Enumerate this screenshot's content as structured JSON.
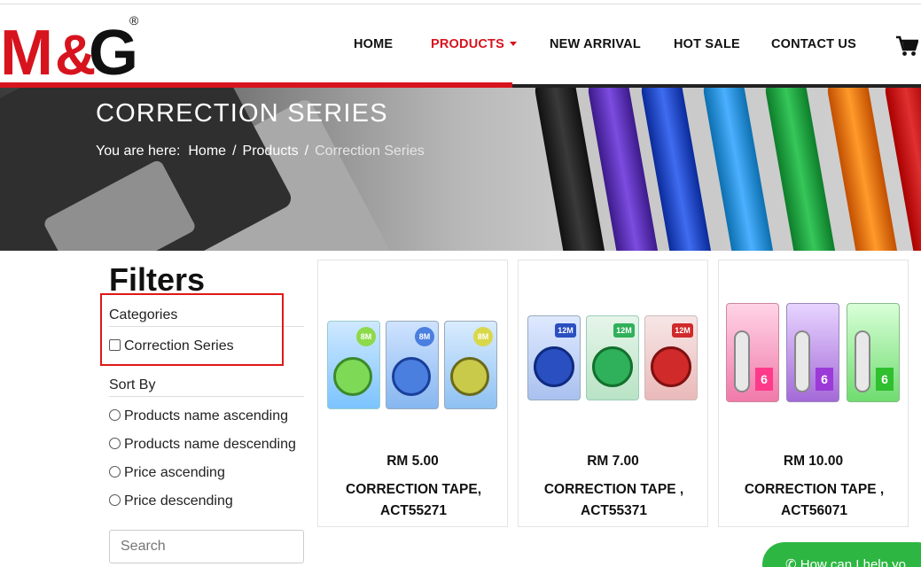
{
  "brand": {
    "logo_text": "M&G",
    "accent": "#d7141e"
  },
  "nav": {
    "items": [
      {
        "label": "HOME"
      },
      {
        "label": "PRODUCTS",
        "active": true
      },
      {
        "label": "NEW ARRIVAL"
      },
      {
        "label": "HOT SALE"
      },
      {
        "label": "CONTACT US"
      }
    ],
    "cart_icon": "cart-icon"
  },
  "hero": {
    "title": "CORRECTION SERIES",
    "breadcrumb": {
      "prefix": "You are here:",
      "items": [
        "Home",
        "Products",
        "Correction Series"
      ],
      "separator": "/"
    }
  },
  "filters": {
    "title": "Filters",
    "categories_title": "Categories",
    "categories": [
      {
        "label": "Correction Series",
        "checked": false
      }
    ],
    "sort_title": "Sort By",
    "sort_options": [
      {
        "label": "Products name ascending"
      },
      {
        "label": "Products name descending"
      },
      {
        "label": "Price ascending"
      },
      {
        "label": "Price descending"
      }
    ],
    "search_placeholder": "Search"
  },
  "products": [
    {
      "price": "RM 5.00",
      "name": "CORRECTION TAPE, ACT55271",
      "pack_label": "8M"
    },
    {
      "price": "RM 7.00",
      "name": "CORRECTION TAPE , ACT55371",
      "pack_label": "12M"
    },
    {
      "price": "RM 10.00",
      "name": "CORRECTION TAPE , ACT56071",
      "pack_label": "6"
    }
  ],
  "chat": {
    "label": "How can I help yo"
  }
}
